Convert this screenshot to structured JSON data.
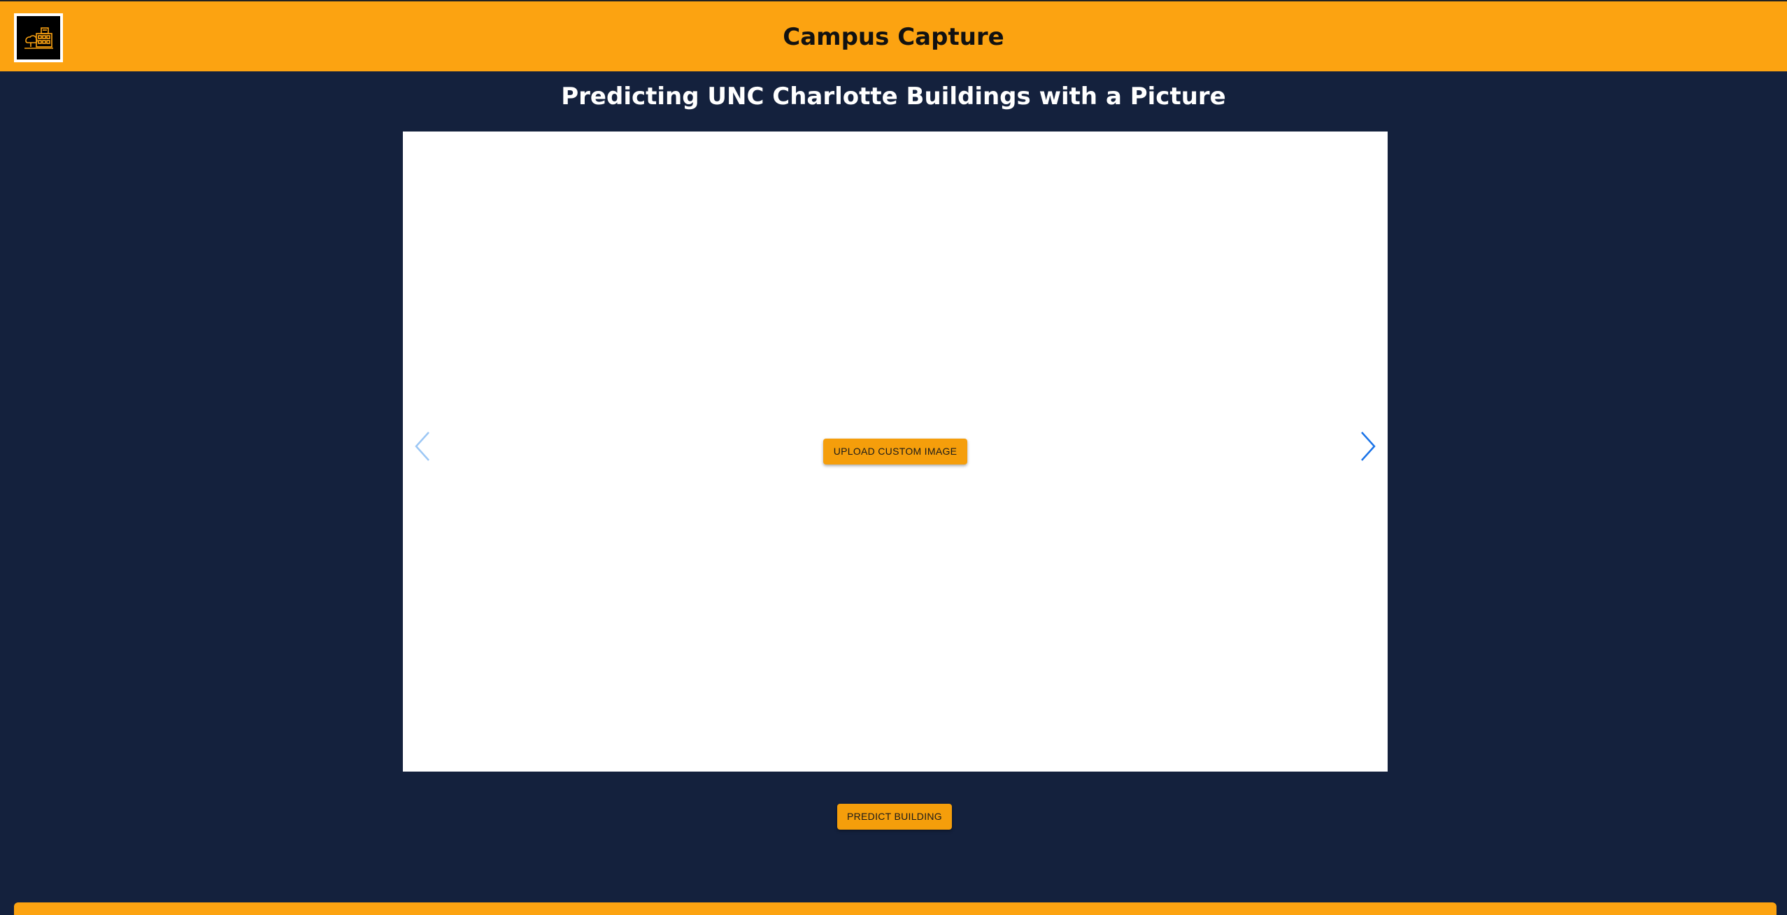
{
  "header": {
    "title": "Campus Capture",
    "logo_icon": "campus-building-logo-icon",
    "background_color": "#fca311"
  },
  "main": {
    "heading": "Predicting UNC Charlotte Buildings with a Picture",
    "background_color": "#14213d",
    "carousel": {
      "upload_label": "UPLOAD CUSTOM IMAGE",
      "prev_icon": "chevron-left-icon",
      "next_icon": "chevron-right-icon"
    },
    "predict_label": "PREDICT BUILDING",
    "accent_color": "#f59e0b"
  }
}
